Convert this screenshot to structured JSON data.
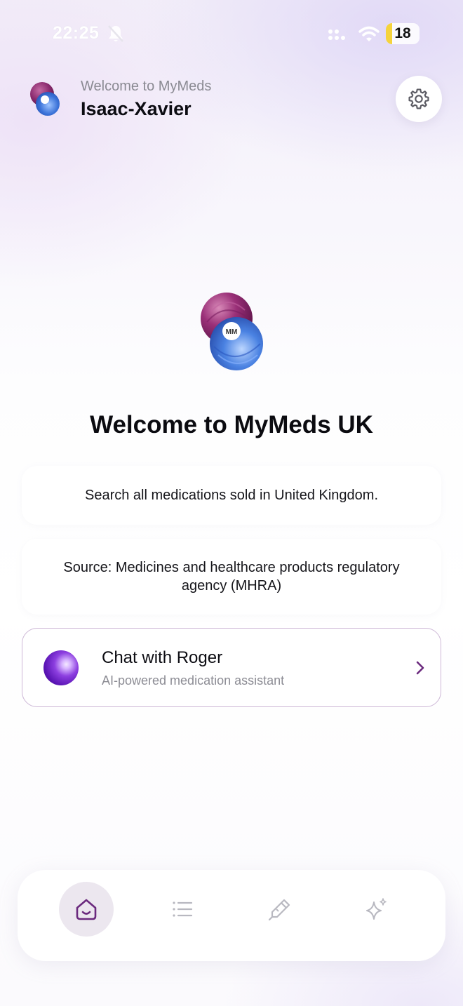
{
  "status_bar": {
    "time": "22:25",
    "battery_level": "18",
    "battery_fraction": 0.18
  },
  "header": {
    "welcome_text": "Welcome to MyMeds",
    "user_name": "Isaac-Xavier"
  },
  "hero": {
    "logo_monogram": "MM",
    "title": "Welcome to MyMeds UK"
  },
  "cards": {
    "search_text": "Search all medications sold in United Kingdom.",
    "source_text": "Source: Medicines and healthcare products regulatory agency (MHRA)"
  },
  "chat": {
    "title": "Chat with Roger",
    "subtitle": "AI-powered medication assistant"
  },
  "nav": {
    "items": [
      {
        "icon": "home-icon",
        "active": true
      },
      {
        "icon": "list-icon",
        "active": false
      },
      {
        "icon": "pen-icon",
        "active": false
      },
      {
        "icon": "sparkle-icon",
        "active": false
      }
    ]
  },
  "colors": {
    "accent": "#6b2a7e",
    "logo_purple": "#8a2a6e",
    "logo_blue": "#3a72d8",
    "inactive_icon": "#b8b8c0"
  }
}
